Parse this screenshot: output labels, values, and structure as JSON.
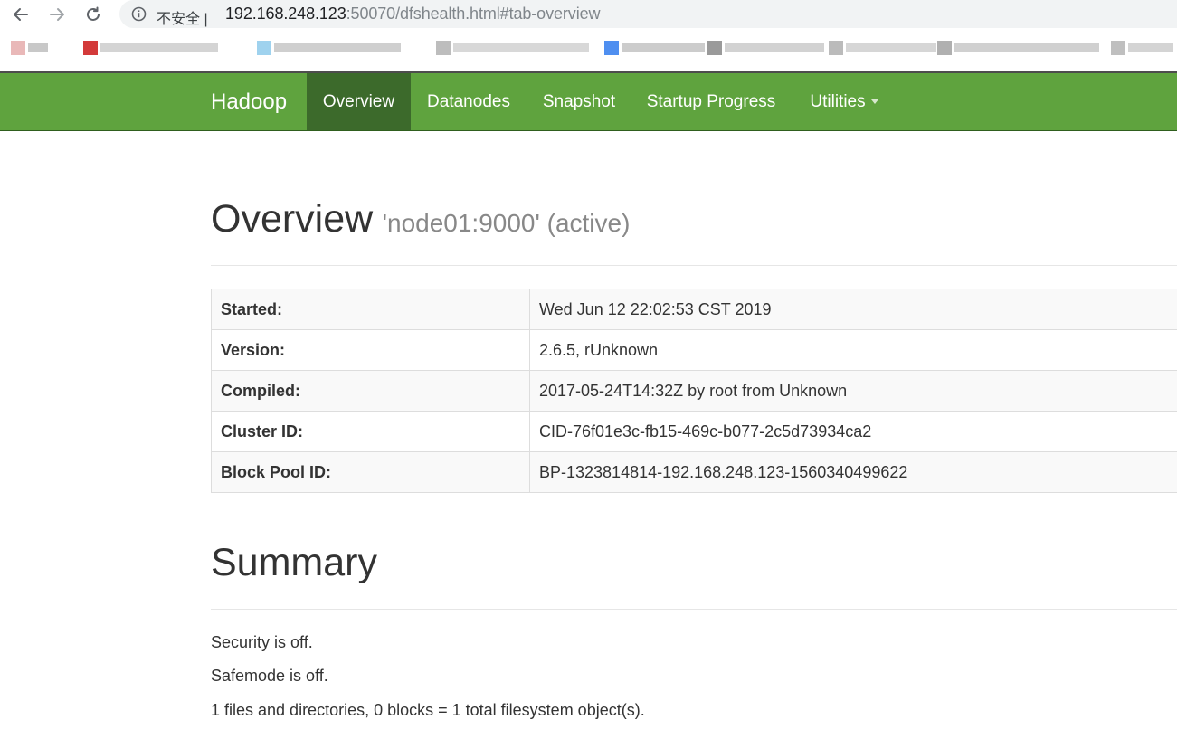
{
  "browser": {
    "security_label": "不安全 |",
    "url_host": "192.168.248.123",
    "url_rest": ":50070/dfshealth.html#tab-overview"
  },
  "navbar": {
    "brand": "Hadoop",
    "items": [
      {
        "label": "Overview",
        "active": true
      },
      {
        "label": "Datanodes"
      },
      {
        "label": "Snapshot"
      },
      {
        "label": "Startup Progress"
      },
      {
        "label": "Utilities",
        "dropdown": true
      }
    ],
    "colors": {
      "bar": "#5fa33e",
      "active": "#3c6a2b"
    }
  },
  "overview": {
    "title": "Overview",
    "subtitle": "'node01:9000' (active)",
    "rows": [
      {
        "key": "Started:",
        "value": "Wed Jun 12 22:02:53 CST 2019"
      },
      {
        "key": "Version:",
        "value": "2.6.5, rUnknown"
      },
      {
        "key": "Compiled:",
        "value": "2017-05-24T14:32Z by root from Unknown"
      },
      {
        "key": "Cluster ID:",
        "value": "CID-76f01e3c-fb15-469c-b077-2c5d73934ca2"
      },
      {
        "key": "Block Pool ID:",
        "value": "BP-1323814814-192.168.248.123-1560340499622"
      }
    ]
  },
  "summary": {
    "title": "Summary",
    "lines": [
      "Security is off.",
      "Safemode is off.",
      "1 files and directories, 0 blocks = 1 total filesystem object(s)."
    ]
  }
}
